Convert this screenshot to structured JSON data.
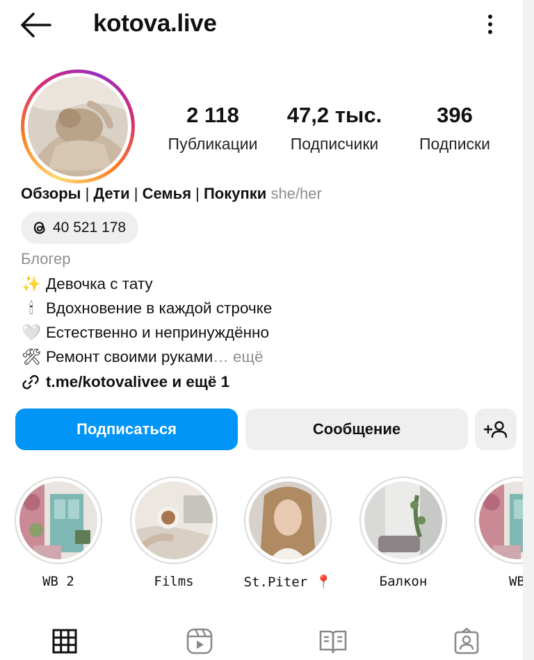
{
  "header": {
    "username": "kotova.live",
    "back_icon": "arrow-left-icon",
    "more_icon": "more-vertical-icon"
  },
  "stats": [
    {
      "value": "2 118",
      "label": "Публикации"
    },
    {
      "value": "47,2 тыс.",
      "label": "Подписчики"
    },
    {
      "value": "396",
      "label": "Подписки"
    }
  ],
  "bio": {
    "categories": [
      "Обзоры",
      "Дети",
      "Семья",
      "Покупки"
    ],
    "separator": " | ",
    "pronouns": "she/her",
    "threads_count": "40 521 178",
    "category_label": "Блогер",
    "lines": [
      {
        "emoji": "✨",
        "text": "Девочка с тату"
      },
      {
        "emoji": "🕯",
        "text": "Вдохновение в каждой строчке"
      },
      {
        "emoji": "🤍",
        "text": "Естественно и непринуждённо"
      },
      {
        "emoji": "🛠",
        "text": "Ремонт своими руками"
      }
    ],
    "truncation": "… ещё",
    "link_text": "t.me/kotovalivee и ещё 1"
  },
  "actions": {
    "follow_label": "Подписаться",
    "message_label": "Сообщение",
    "add_person_icon": "add-person-icon"
  },
  "highlights": [
    {
      "name": "WB 2"
    },
    {
      "name": "Films"
    },
    {
      "name": "St.Piter",
      "emoji": "📍"
    },
    {
      "name": "Балкон"
    },
    {
      "name": "WB"
    }
  ],
  "tabs": [
    {
      "icon": "grid-icon",
      "active": true
    },
    {
      "icon": "reels-icon",
      "active": false
    },
    {
      "icon": "guides-icon",
      "active": false
    },
    {
      "icon": "tagged-icon",
      "active": false
    }
  ],
  "colors": {
    "accent": "#0095f6",
    "secondary_button": "#efefef",
    "muted_text": "#8e8e8e"
  }
}
